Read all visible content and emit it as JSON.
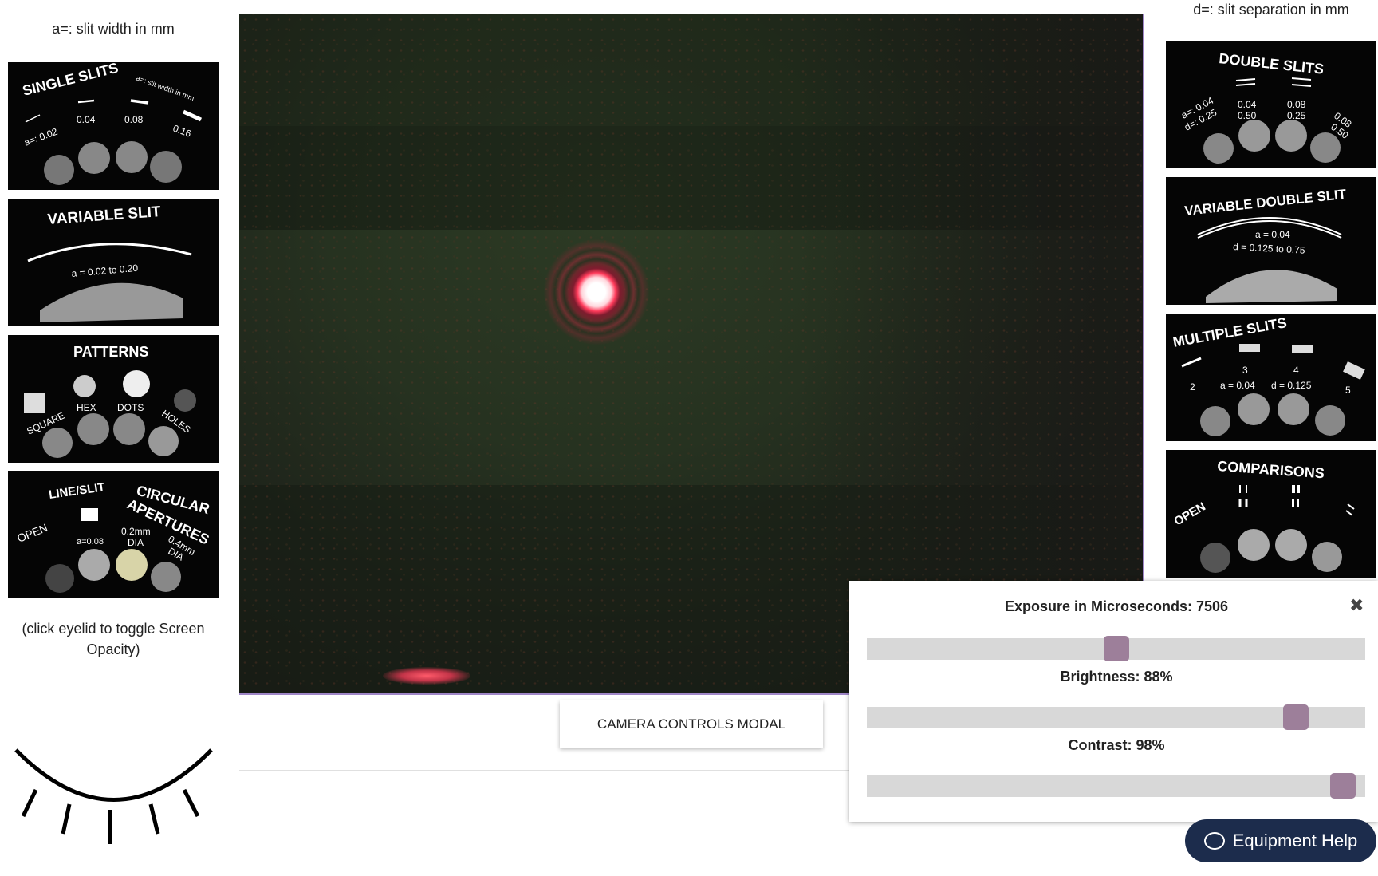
{
  "left": {
    "caption": "a=: slit width in mm",
    "toggle_hint": "(click eyelid to toggle Screen Opacity)",
    "slides": {
      "single": {
        "title": "SINGLE SLITS",
        "note": "a=: slit width in mm",
        "labels": [
          "a=: 0.02",
          "0.04",
          "0.08",
          "0.16"
        ]
      },
      "variable": {
        "title": "VARIABLE SLIT",
        "range": "a = 0.02 to 0.20"
      },
      "patterns": {
        "title": "PATTERNS",
        "labels": [
          "SQUARE",
          "HEX",
          "DOTS",
          "HOLES"
        ]
      },
      "line": {
        "title_a": "LINE/SLIT",
        "title_b": "CIRCULAR",
        "title_c": "APERTURES",
        "labels": [
          "OPEN",
          "a=0.08",
          "0.2mm",
          "DIA",
          "0.4mm",
          "DIA"
        ]
      }
    }
  },
  "right": {
    "caption": "d=: slit separation in mm",
    "slides": {
      "double": {
        "title": "DOUBLE SLITS",
        "labels": [
          "a=: 0.04",
          "d=: 0.25",
          "0.04",
          "0.50",
          "0.08",
          "0.25",
          "0.08",
          "0.50"
        ]
      },
      "vardouble": {
        "title": "VARIABLE DOUBLE SLIT",
        "a": "a = 0.04",
        "d": "d = 0.125 to 0.75"
      },
      "multiple": {
        "title": "MULTIPLE SLITS",
        "labels": [
          "2",
          "3",
          "4",
          "5",
          "a = 0.04",
          "d = 0.125"
        ]
      },
      "comparisons": {
        "title": "COMPARISONS",
        "labels": [
          "OPEN"
        ]
      }
    }
  },
  "camera_button": "CAMERA CONTROLS MODAL",
  "controls": {
    "exposure_label": "Exposure in Microseconds: 7506",
    "exposure_level": 0.5,
    "brightness_label": "Brightness: 88%",
    "brightness_level": 0.88,
    "contrast_label": "Contrast: 98%",
    "contrast_level": 0.98
  },
  "help_button": "Equipment Help",
  "icons": {
    "close": "close-icon",
    "chat": "chat-bubble-icon",
    "eyelid": "eyelid-icon"
  }
}
